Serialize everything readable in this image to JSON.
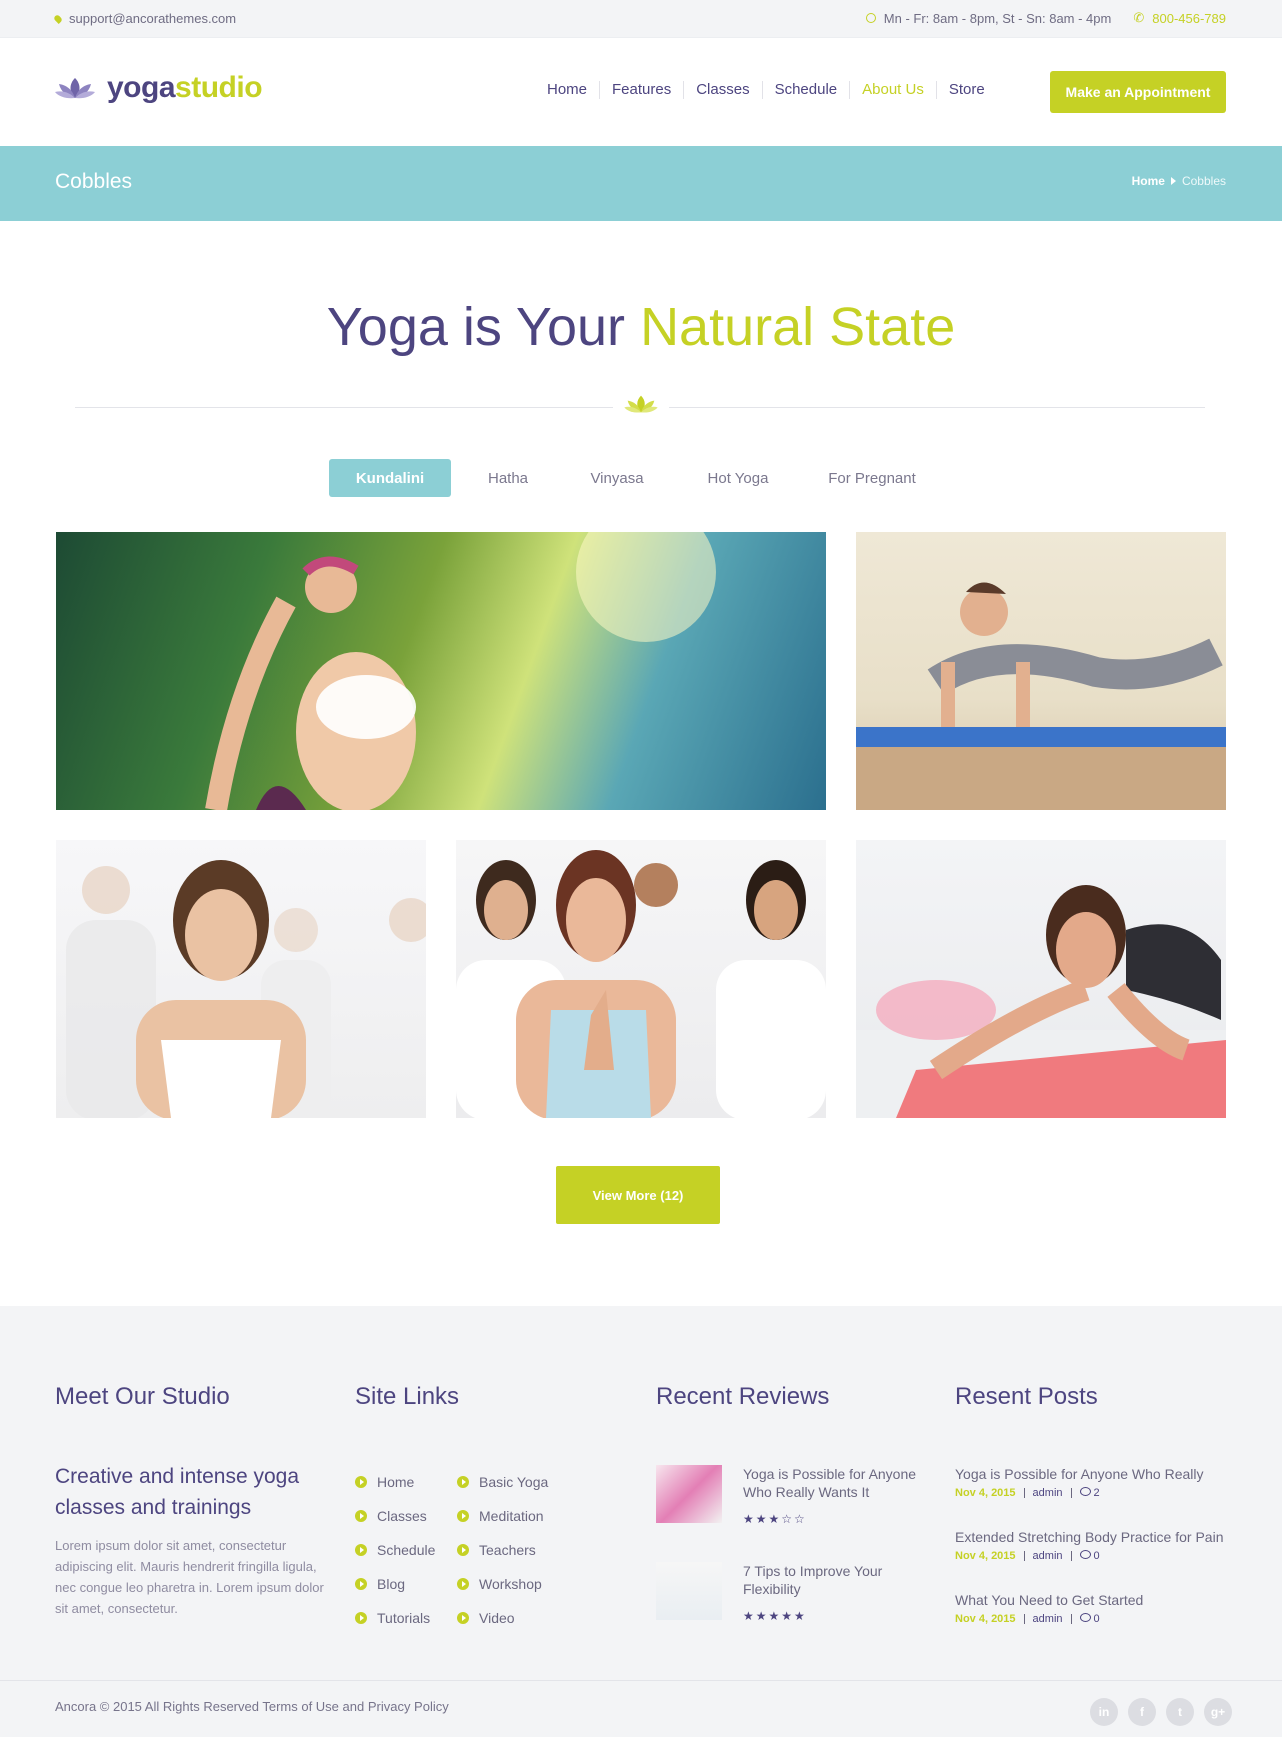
{
  "topbar": {
    "email": "support@ancorathemes.com",
    "hours": "Mn - Fr: 8am - 8pm, St - Sn: 8am - 4pm",
    "phone": "800-456-789"
  },
  "header": {
    "logo_part1": "yoga",
    "logo_part2": "studio",
    "nav": [
      {
        "label": "Home"
      },
      {
        "label": "Features"
      },
      {
        "label": "Classes"
      },
      {
        "label": "Schedule"
      },
      {
        "label": "About Us",
        "active": true
      },
      {
        "label": "Store"
      }
    ],
    "cta_label": "Make an Appointment"
  },
  "page_band": {
    "title": "Cobbles",
    "breadcrumb_home": "Home",
    "breadcrumb_current": "Cobbles"
  },
  "hero": {
    "heading_part1": "Yoga is Your",
    "heading_part2": "Natural State"
  },
  "tabs": [
    "Kundalini",
    "Hatha",
    "Vinyasa",
    "Hot Yoga",
    "For Pregnant"
  ],
  "gallery": {
    "view_more": "View More (12)"
  },
  "footer": {
    "studio": {
      "heading": "Meet Our Studio",
      "subheading": "Creative and intense yoga classes and trainings",
      "text": "Lorem ipsum dolor sit amet, consectetur adipiscing elit. Mauris hendrerit fringilla ligula, nec congue leo pharetra in. Lorem ipsum dolor sit amet, consectetur."
    },
    "site_links": {
      "heading": "Site Links",
      "col1": [
        "Home",
        "Classes",
        "Schedule",
        "Blog",
        "Tutorials"
      ],
      "col2": [
        "Basic Yoga",
        "Meditation",
        "Teachers",
        "Workshop",
        "Video"
      ]
    },
    "reviews": {
      "heading": "Recent Reviews",
      "items": [
        {
          "title": "Yoga is Possible for Anyone Who Really Wants It",
          "stars": "★★★☆☆"
        },
        {
          "title": "7 Tips to Improve Your Flexibility",
          "stars": "★★★★★"
        }
      ]
    },
    "posts": {
      "heading": "Resent Posts",
      "items": [
        {
          "title": "Yoga is Possible for Anyone Who Really",
          "date": "Nov 4, 2015",
          "author": "admin",
          "comments": "2"
        },
        {
          "title": "Extended Stretching Body Practice for Pain",
          "date": "Nov 4, 2015",
          "author": "admin",
          "comments": "0"
        },
        {
          "title": "What You Need to Get Started",
          "date": "Nov 4, 2015",
          "author": "admin",
          "comments": "0"
        }
      ]
    },
    "copyright": "Ancora © 2015 All Rights Reserved Terms of Use and Privacy Policy",
    "social": [
      "in",
      "f",
      "t",
      "g+"
    ]
  },
  "colors": {
    "accent": "#c5d125",
    "purple": "#4d4580",
    "teal": "#8ccfd5"
  }
}
